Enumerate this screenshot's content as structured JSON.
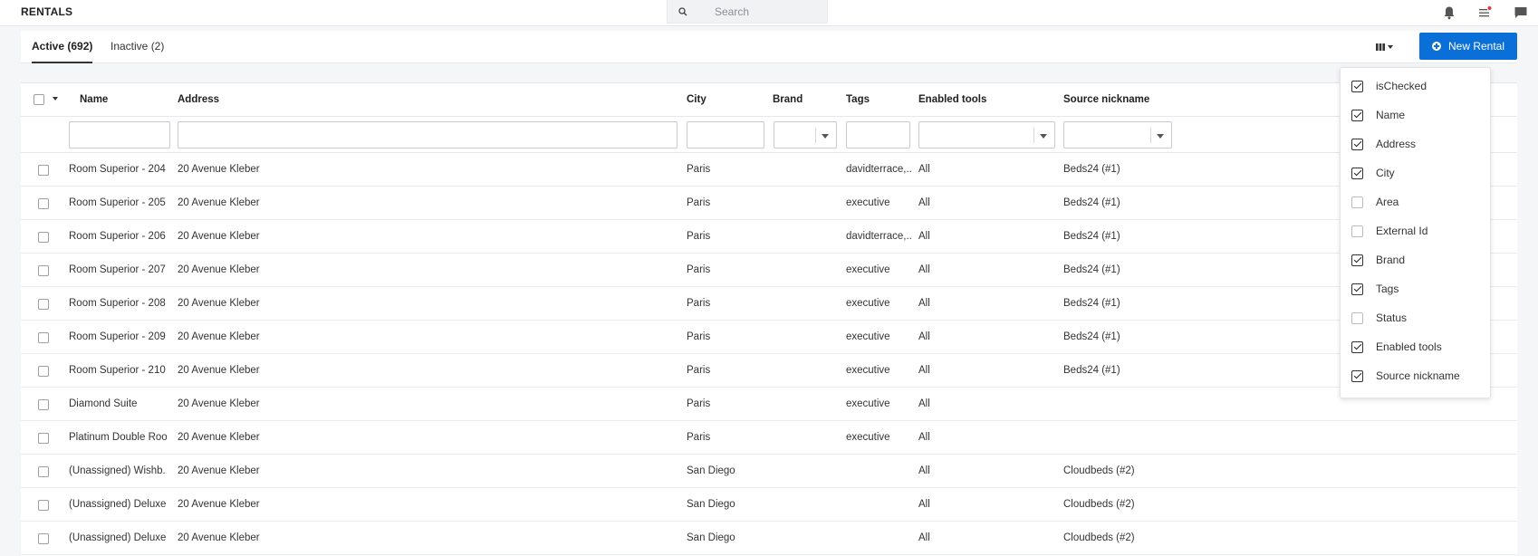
{
  "header": {
    "title": "RENTALS",
    "search_placeholder": "Search"
  },
  "tabs": [
    {
      "label": "Active (692)",
      "active": true
    },
    {
      "label": "Inactive (2)",
      "active": false
    }
  ],
  "toolbar": {
    "new_rental_label": "New Rental"
  },
  "table": {
    "columns": [
      "Name",
      "Address",
      "City",
      "Brand",
      "Tags",
      "Enabled tools",
      "Source nickname"
    ],
    "rows": [
      {
        "name": "Room Superior - 204",
        "address": "20 Avenue Kleber",
        "city": "Paris",
        "brand": "",
        "tags": "davidterrace,...",
        "tools": "All",
        "source": "Beds24 (#1)"
      },
      {
        "name": "Room Superior - 205",
        "address": "20 Avenue Kleber",
        "city": "Paris",
        "brand": "",
        "tags": "executive",
        "tools": "All",
        "source": "Beds24 (#1)"
      },
      {
        "name": "Room Superior - 206",
        "address": "20 Avenue Kleber",
        "city": "Paris",
        "brand": "",
        "tags": "davidterrace,...",
        "tools": "All",
        "source": "Beds24 (#1)"
      },
      {
        "name": "Room Superior - 207",
        "address": "20 Avenue Kleber",
        "city": "Paris",
        "brand": "",
        "tags": "executive",
        "tools": "All",
        "source": "Beds24 (#1)"
      },
      {
        "name": "Room Superior - 208",
        "address": "20 Avenue Kleber",
        "city": "Paris",
        "brand": "",
        "tags": "executive",
        "tools": "All",
        "source": "Beds24 (#1)"
      },
      {
        "name": "Room Superior - 209",
        "address": "20 Avenue Kleber",
        "city": "Paris",
        "brand": "",
        "tags": "executive",
        "tools": "All",
        "source": "Beds24 (#1)"
      },
      {
        "name": "Room Superior - 210",
        "address": "20 Avenue Kleber",
        "city": "Paris",
        "brand": "",
        "tags": "executive",
        "tools": "All",
        "source": "Beds24 (#1)"
      },
      {
        "name": "Diamond Suite",
        "address": "20 Avenue Kleber",
        "city": "Paris",
        "brand": "",
        "tags": "executive",
        "tools": "All",
        "source": ""
      },
      {
        "name": "Platinum Double Roo...",
        "address": "20 Avenue Kleber",
        "city": "Paris",
        "brand": "",
        "tags": "executive",
        "tools": "All",
        "source": ""
      },
      {
        "name": "(Unassigned) Wishb...",
        "address": "20 Avenue Kleber",
        "city": "San Diego",
        "brand": "",
        "tags": "",
        "tools": "All",
        "source": "Cloudbeds (#2)"
      },
      {
        "name": "(Unassigned) Deluxe...",
        "address": "20 Avenue Kleber",
        "city": "San Diego",
        "brand": "",
        "tags": "",
        "tools": "All",
        "source": "Cloudbeds (#2)"
      },
      {
        "name": "(Unassigned) Deluxe...",
        "address": "20 Avenue Kleber",
        "city": "San Diego",
        "brand": "",
        "tags": "",
        "tools": "All",
        "source": "Cloudbeds (#2)"
      }
    ]
  },
  "column_menu": [
    {
      "label": "isChecked",
      "checked": true
    },
    {
      "label": "Name",
      "checked": true
    },
    {
      "label": "Address",
      "checked": true
    },
    {
      "label": "City",
      "checked": true
    },
    {
      "label": "Area",
      "checked": false
    },
    {
      "label": "External Id",
      "checked": false
    },
    {
      "label": "Brand",
      "checked": true
    },
    {
      "label": "Tags",
      "checked": true
    },
    {
      "label": "Status",
      "checked": false
    },
    {
      "label": "Enabled tools",
      "checked": true
    },
    {
      "label": "Source nickname",
      "checked": true
    }
  ],
  "colors": {
    "primary": "#0a6fd6",
    "text": "#333333",
    "border": "#e6e8eb"
  }
}
